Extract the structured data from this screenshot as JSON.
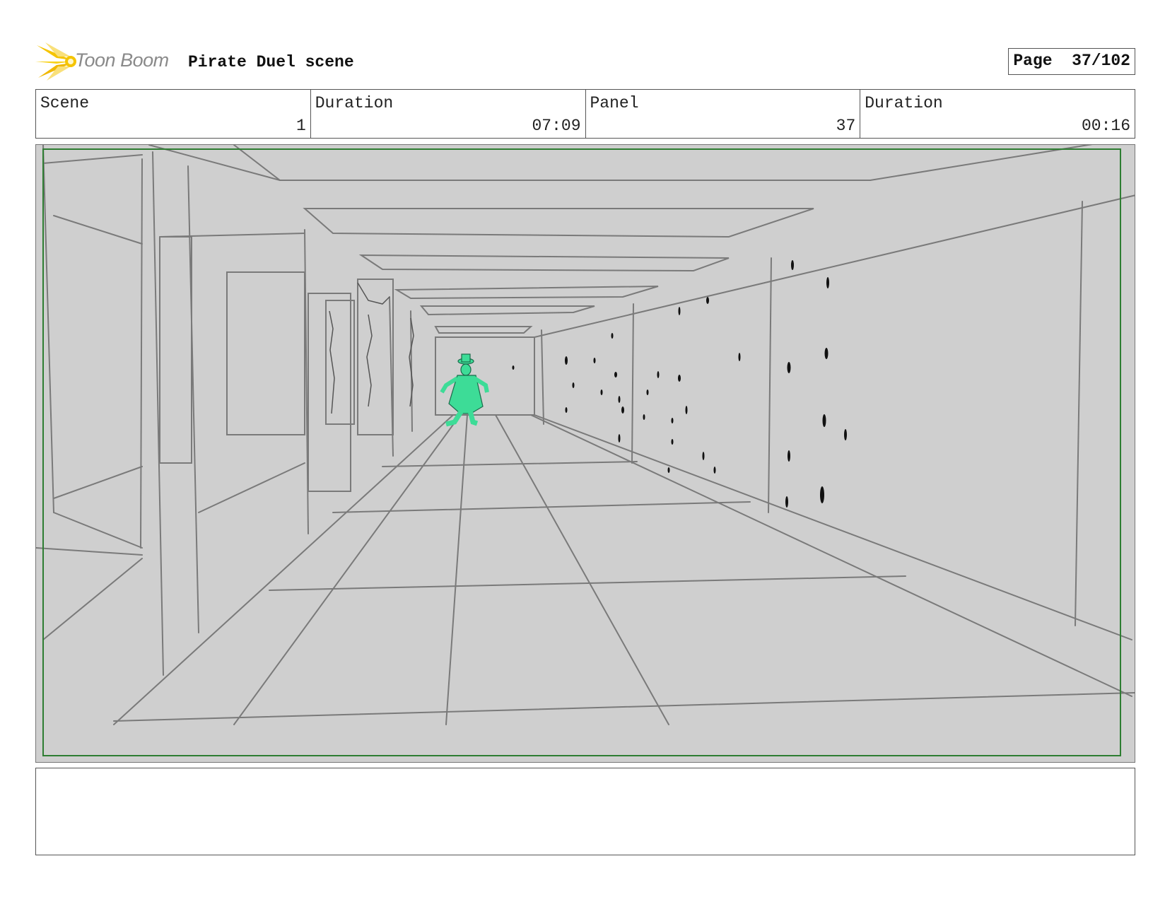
{
  "header": {
    "logo_text": "Toon Boom",
    "title": "Pirate Duel scene",
    "page_label": "Page",
    "page_number": "37/102"
  },
  "info": {
    "scene_label": "Scene",
    "scene_value": "1",
    "scene_duration_label": "Duration",
    "scene_duration_value": "07:09",
    "panel_label": "Panel",
    "panel_value": "37",
    "panel_duration_label": "Duration",
    "panel_duration_value": "00:16"
  },
  "colors": {
    "panel_background": "#cfcfcf",
    "safe_frame": "#2e7d32",
    "character": "#3ddc97",
    "logo_flare": "#f5c400"
  },
  "notes": {
    "text": ""
  }
}
